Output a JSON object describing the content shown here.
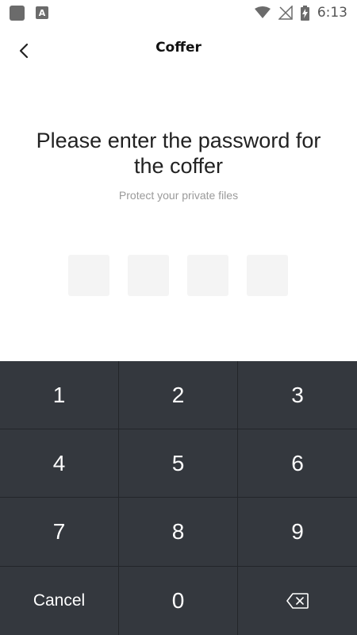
{
  "status_bar": {
    "time": "6:13",
    "notification_letter": "A"
  },
  "app_bar": {
    "title": "Coffer"
  },
  "prompt": {
    "title": "Please enter the password for the coffer",
    "subtitle": "Protect your private files"
  },
  "pin": {
    "length": 4
  },
  "keypad": {
    "keys": [
      "1",
      "2",
      "3",
      "4",
      "5",
      "6",
      "7",
      "8",
      "9"
    ],
    "cancel_label": "Cancel",
    "zero_label": "0"
  },
  "colors": {
    "keypad_bg": "#34383e",
    "pin_box": "#f4f4f4",
    "text_primary": "#222222",
    "text_secondary": "#9a9a9a"
  }
}
